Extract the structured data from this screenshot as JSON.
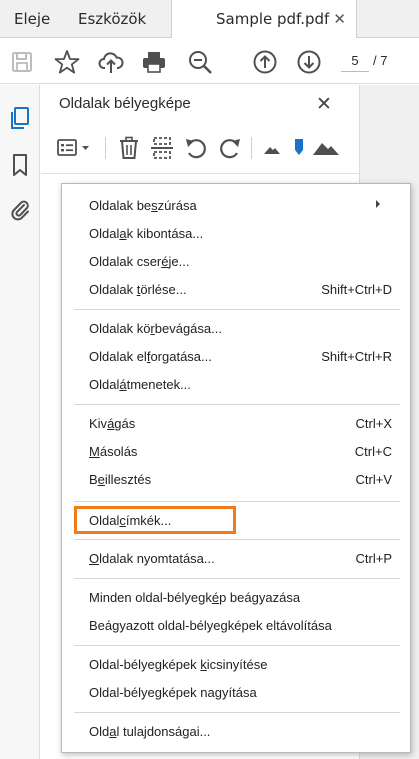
{
  "tabs": {
    "home": "Eleje",
    "tools": "Eszközök",
    "document": "Sample pdf.pdf",
    "close_glyph": "✕"
  },
  "toolbar": {
    "icons": [
      "save-icon",
      "star-icon",
      "upload-cloud-icon",
      "print-icon",
      "zoom-out-icon",
      "previous-page-icon",
      "next-page-icon"
    ],
    "current_page": "5",
    "total_pages": "/ 7"
  },
  "rail": {
    "icons": [
      "page-thumbnails-icon",
      "bookmark-icon",
      "attachment-icon"
    ]
  },
  "panel": {
    "title": "Oldalak bélyegképe",
    "close_glyph": "✕",
    "tool_icons": [
      "options-menu-icon",
      "delete-icon",
      "extract-icon",
      "rotate-counterclockwise-icon",
      "rotate-clockwise-icon",
      "zoom-small-icon",
      "pin-icon",
      "zoom-large-icon"
    ]
  },
  "menu": {
    "highlight_color": "#f07b1a",
    "items": [
      {
        "pre": "Oldalak be",
        "u": "s",
        "post": "zúrása",
        "shortcut": "",
        "submenu": true
      },
      {
        "pre": "Oldal",
        "u": "a",
        "post": "k kibontása...",
        "shortcut": "",
        "submenu": false
      },
      {
        "pre": "Oldalak cser",
        "u": "é",
        "post": "je...",
        "shortcut": "",
        "submenu": false
      },
      {
        "pre": "Oldalak ",
        "u": "t",
        "post": "örlése...",
        "shortcut": "Shift+Ctrl+D",
        "submenu": false
      },
      {
        "pre": "Oldalak kö",
        "u": "r",
        "post": "bevágása...",
        "shortcut": "",
        "submenu": false
      },
      {
        "pre": "Oldalak el",
        "u": "f",
        "post": "orgatása...",
        "shortcut": "Shift+Ctrl+R",
        "submenu": false
      },
      {
        "pre": "Oldal",
        "u": "á",
        "post": "tmenetek...",
        "shortcut": "",
        "submenu": false
      },
      {
        "pre": "Kiv",
        "u": "á",
        "post": "gás",
        "shortcut": "Ctrl+X",
        "submenu": false
      },
      {
        "pre": "",
        "u": "M",
        "post": "ásolás",
        "shortcut": "Ctrl+C",
        "submenu": false
      },
      {
        "pre": "B",
        "u": "e",
        "post": "illesztés",
        "shortcut": "Ctrl+V",
        "submenu": false
      },
      {
        "pre": "Oldal",
        "u": "c",
        "post": "ímkék...",
        "shortcut": "",
        "submenu": false
      },
      {
        "pre": "",
        "u": "O",
        "post": "ldalak nyomtatása...",
        "shortcut": "Ctrl+P",
        "submenu": false
      },
      {
        "pre": "Minden oldal-bélyegk",
        "u": "é",
        "post": "p beágyazása",
        "shortcut": "",
        "submenu": false
      },
      {
        "pre": "Beágyazott oldal-bélyegképek eltávolítása",
        "u": "",
        "post": "",
        "shortcut": "",
        "submenu": false
      },
      {
        "pre": "Oldal-bélyegképek ",
        "u": "k",
        "post": "icsinyítése",
        "shortcut": "",
        "submenu": false
      },
      {
        "pre": "Oldal-bélyegképek na",
        "u": "g",
        "post": "yítása",
        "shortcut": "",
        "submenu": false
      },
      {
        "pre": "Old",
        "u": "a",
        "post": "l tulajdonságai...",
        "shortcut": "",
        "submenu": false
      }
    ]
  }
}
